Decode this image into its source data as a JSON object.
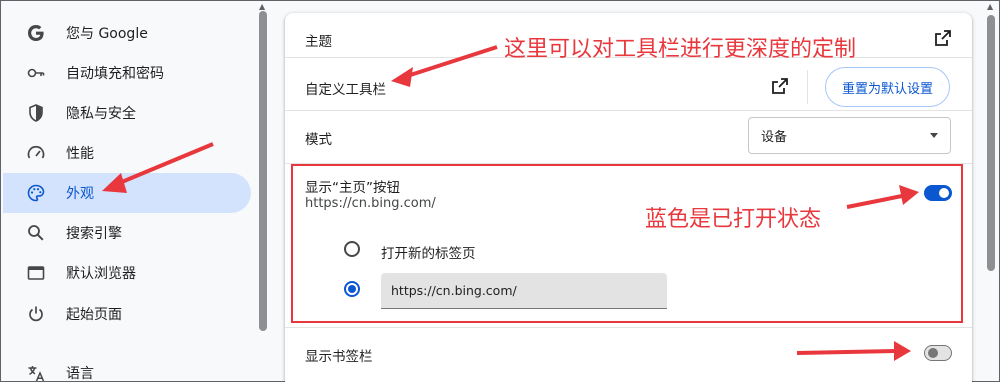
{
  "sidebar": {
    "items": [
      {
        "label": "您与 Google",
        "icon": "google-g-icon"
      },
      {
        "label": "自动填充和密码",
        "icon": "key-icon"
      },
      {
        "label": "隐私与安全",
        "icon": "shield-icon"
      },
      {
        "label": "性能",
        "icon": "speedometer-icon"
      },
      {
        "label": "外观",
        "icon": "palette-icon",
        "active": true
      },
      {
        "label": "搜索引擎",
        "icon": "search-icon"
      },
      {
        "label": "默认浏览器",
        "icon": "browser-window-icon"
      },
      {
        "label": "起始页面",
        "icon": "power-icon"
      },
      {
        "label": "语言",
        "icon": "translate-icon"
      }
    ]
  },
  "main": {
    "theme_label": "主题",
    "customize_toolbar_label": "自定义工具栏",
    "reset_button": "重置为默认设置",
    "mode_label": "模式",
    "mode_value": "设备",
    "home_button": {
      "label": "显示“主页”按钮",
      "url": "https://cn.bing.com/",
      "enabled": true,
      "option_new_tab": "打开新的标签页",
      "option_url_value": "https://cn.bing.com/",
      "selected_option": "custom_url"
    },
    "bookmarks_bar": {
      "label": "显示书签栏",
      "enabled": false
    }
  },
  "annotations": {
    "toolbar_note": "这里可以对工具栏进行更深度的定制",
    "toggle_note": "蓝色是已打开状态",
    "color": "#e8383d"
  },
  "colors": {
    "accent": "#0b57d0",
    "active_nav_bg": "#d3e3fd",
    "page_bg": "#f8f9fa"
  }
}
